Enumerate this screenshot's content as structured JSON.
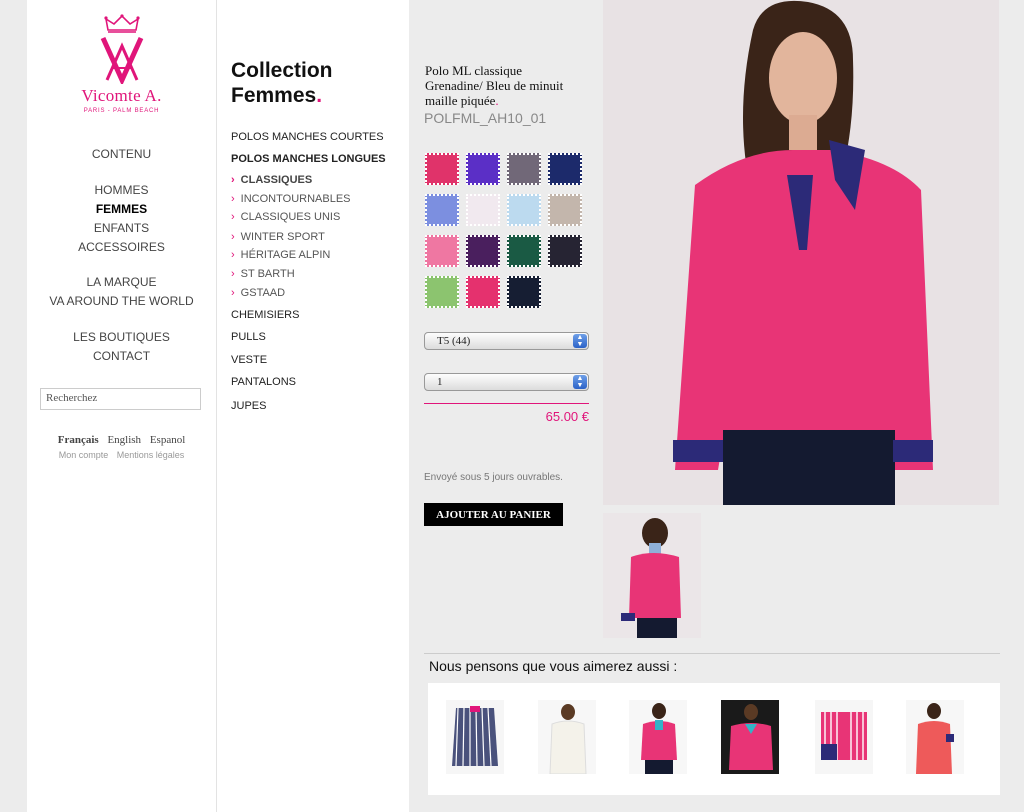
{
  "brand": {
    "name": "Vicomte A.",
    "tagline": "PARIS - PALM BEACH",
    "color": "#e0157a"
  },
  "left_nav": {
    "contenu": "CONTENU",
    "group1": [
      "HOMMES",
      "FEMMES",
      "ENFANTS",
      "ACCESSOIRES"
    ],
    "group2": [
      "LA MARQUE",
      "VA AROUND THE WORLD"
    ],
    "group3": [
      "LES BOUTIQUES",
      "CONTACT"
    ],
    "active": "FEMMES"
  },
  "search": {
    "placeholder": "Recherchez"
  },
  "languages": [
    "Français",
    "English",
    "Espanol"
  ],
  "current_language": "Français",
  "footer_links": [
    "Mon compte",
    "Mentions légales"
  ],
  "collection": {
    "title_line1": "Collection",
    "title_line2": "Femmes",
    "dot": "."
  },
  "categories": {
    "polos_courtes": "POLOS MANCHES COURTES",
    "polos_longues": "POLOS MANCHES LONGUES",
    "subs": [
      "CLASSIQUES",
      "INCONTOURNABLES",
      "CLASSIQUES UNIS",
      "WINTER SPORT",
      "HÉRITAGE ALPIN",
      "ST BARTH",
      "GSTAAD"
    ],
    "active_sub": "CLASSIQUES",
    "rest": [
      "CHEMISIERS",
      "PULLS",
      "VESTE",
      "PANTALONS",
      "JUPES"
    ]
  },
  "product": {
    "title_line1": "Polo ML classique",
    "title_line2": "Grenadine/ Bleu de minuit",
    "title_line3": "maille piquée",
    "dot": ".",
    "sku": "POLFML_AH10_01",
    "size_selected": "T5 (44)",
    "quantity_selected": "1",
    "price": "65.00 €",
    "shipping": "Envoyé sous 5 jours ouvrables.",
    "add_to_cart": "AJOUTER AU PANIER"
  },
  "swatches": [
    "#e0336a",
    "#5b2fc6",
    "#716878",
    "#1c2a6b",
    "#7c8fe0",
    "#f1e9ef",
    "#bcdaef",
    "#c3b6ac",
    "#ef77a2",
    "#4a1f5e",
    "#1a5a44",
    "#262433",
    "#8cc46f",
    "#e5316e",
    "#161e33"
  ],
  "recommendations": {
    "title": "Nous pensons que vous aimerez aussi :",
    "items": [
      "striped-shirt-navy",
      "white-sweater",
      "pink-polo",
      "pink-sweater",
      "pink-striped-shirt",
      "coral-polo"
    ]
  }
}
